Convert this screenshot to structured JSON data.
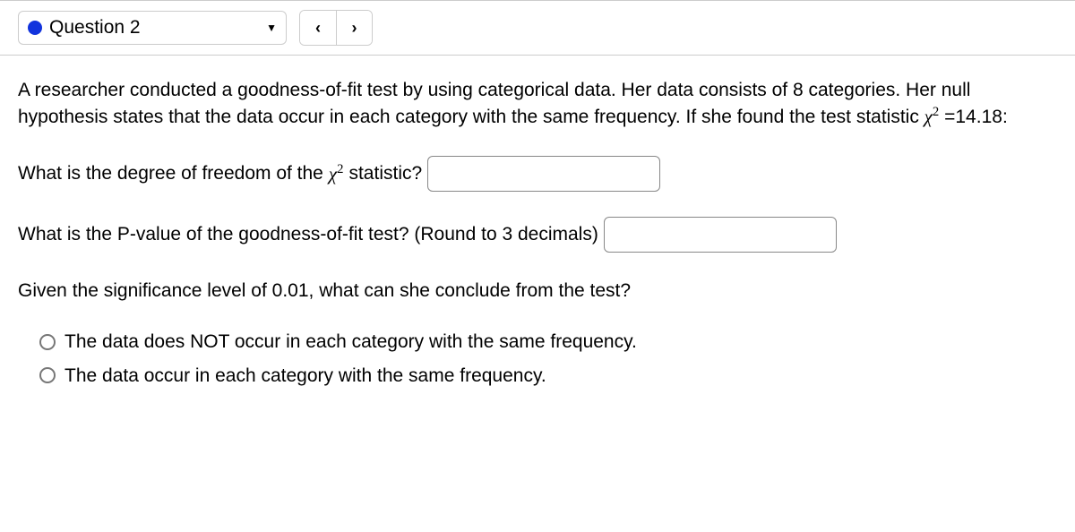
{
  "topbar": {
    "question_label": "Question 2",
    "prev_icon": "‹",
    "next_icon": "›"
  },
  "body": {
    "intro_pre": "A researcher conducted a goodness-of-fit test by using categorical data. Her data consists of 8 categories. Her null hypothesis states that the data occur in each category with the same frequency. If she found the test statistic ",
    "chi_symbol": "χ",
    "chi_exp": "2",
    "intro_mid": " =",
    "test_stat": "14.18",
    "intro_post": ":",
    "q1_pre": "What is the degree of freedom of the ",
    "q1_post": " statistic?",
    "q2_text": "What is the P-value of the goodness-of-fit test? (Round to 3 decimals)",
    "q3_text": "Given the significance level of 0.01, what can she conclude from the test?",
    "options": [
      "The data does NOT occur in each category with the same frequency.",
      "The data occur in each category with the same frequency."
    ]
  }
}
